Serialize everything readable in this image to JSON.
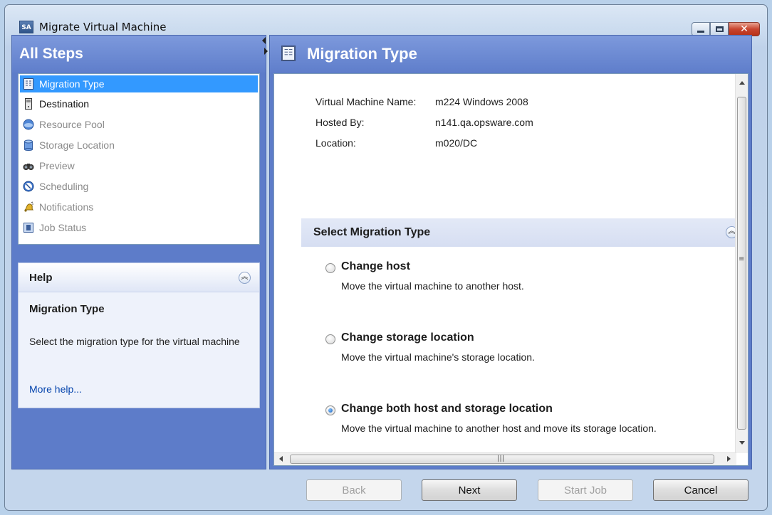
{
  "window": {
    "app_icon_text": "SA",
    "title": "Migrate Virtual Machine"
  },
  "left_panel": {
    "header": "All Steps",
    "steps": [
      {
        "label": "Migration Type",
        "icon": "migration-type-icon",
        "state": "active"
      },
      {
        "label": "Destination",
        "icon": "server-icon",
        "state": "enabled"
      },
      {
        "label": "Resource Pool",
        "icon": "resource-pool-icon",
        "state": "disabled"
      },
      {
        "label": "Storage Location",
        "icon": "database-icon",
        "state": "disabled"
      },
      {
        "label": "Preview",
        "icon": "binoculars-icon",
        "state": "disabled"
      },
      {
        "label": "Scheduling",
        "icon": "clock-icon",
        "state": "disabled"
      },
      {
        "label": "Notifications",
        "icon": "bell-icon",
        "state": "disabled"
      },
      {
        "label": "Job Status",
        "icon": "job-status-icon",
        "state": "disabled"
      }
    ]
  },
  "help": {
    "title": "Help",
    "subtitle": "Migration Type",
    "text": "Select the migration type for the virtual machine",
    "link": "More help..."
  },
  "main": {
    "title": "Migration Type",
    "info": [
      {
        "label": "Virtual Machine Name:",
        "value": "m224 Windows 2008"
      },
      {
        "label": "Hosted By:",
        "value": "n141.qa.opsware.com"
      },
      {
        "label": "Location:",
        "value": "m020/DC"
      }
    ],
    "section_title": "Select Migration Type",
    "options": [
      {
        "label": "Change host",
        "description": "Move the virtual machine to another host.",
        "selected": false
      },
      {
        "label": "Change storage location",
        "description": "Move the virtual machine's storage location.",
        "selected": false
      },
      {
        "label": "Change both host and storage location",
        "description": "Move the virtual machine to another host and move its storage location.",
        "selected": true
      }
    ]
  },
  "buttons": {
    "back": "Back",
    "next": "Next",
    "start_job": "Start Job",
    "cancel": "Cancel"
  },
  "colors": {
    "panel_blue": "#5d7cc9",
    "selection": "#3399ff",
    "link": "#0645ad"
  }
}
